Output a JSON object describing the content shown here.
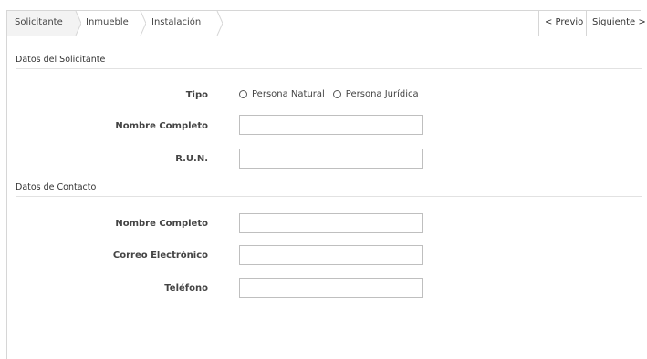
{
  "wizard": {
    "steps": [
      {
        "label": "Solicitante"
      },
      {
        "label": "Inmueble"
      },
      {
        "label": "Instalación"
      }
    ],
    "prev_label": "< Previo",
    "next_label": "Siguiente >"
  },
  "applicant_section": {
    "title": "Datos del Solicitante",
    "tipo_label": "Tipo",
    "radio_natural_label": "Persona Natural",
    "radio_juridica_label": "Persona Jurídica",
    "nombre_label": "Nombre Completo",
    "nombre_value": "",
    "run_label": "R.U.N.",
    "run_value": ""
  },
  "contact_section": {
    "title": "Datos de Contacto",
    "nombre_label": "Nombre Completo",
    "nombre_value": "",
    "correo_label": "Correo Electrónico",
    "correo_value": "",
    "telefono_label": "Teléfono",
    "telefono_value": ""
  },
  "colors": {
    "active_step_bg": "#f3f3f3",
    "border": "#d6d6d6"
  }
}
